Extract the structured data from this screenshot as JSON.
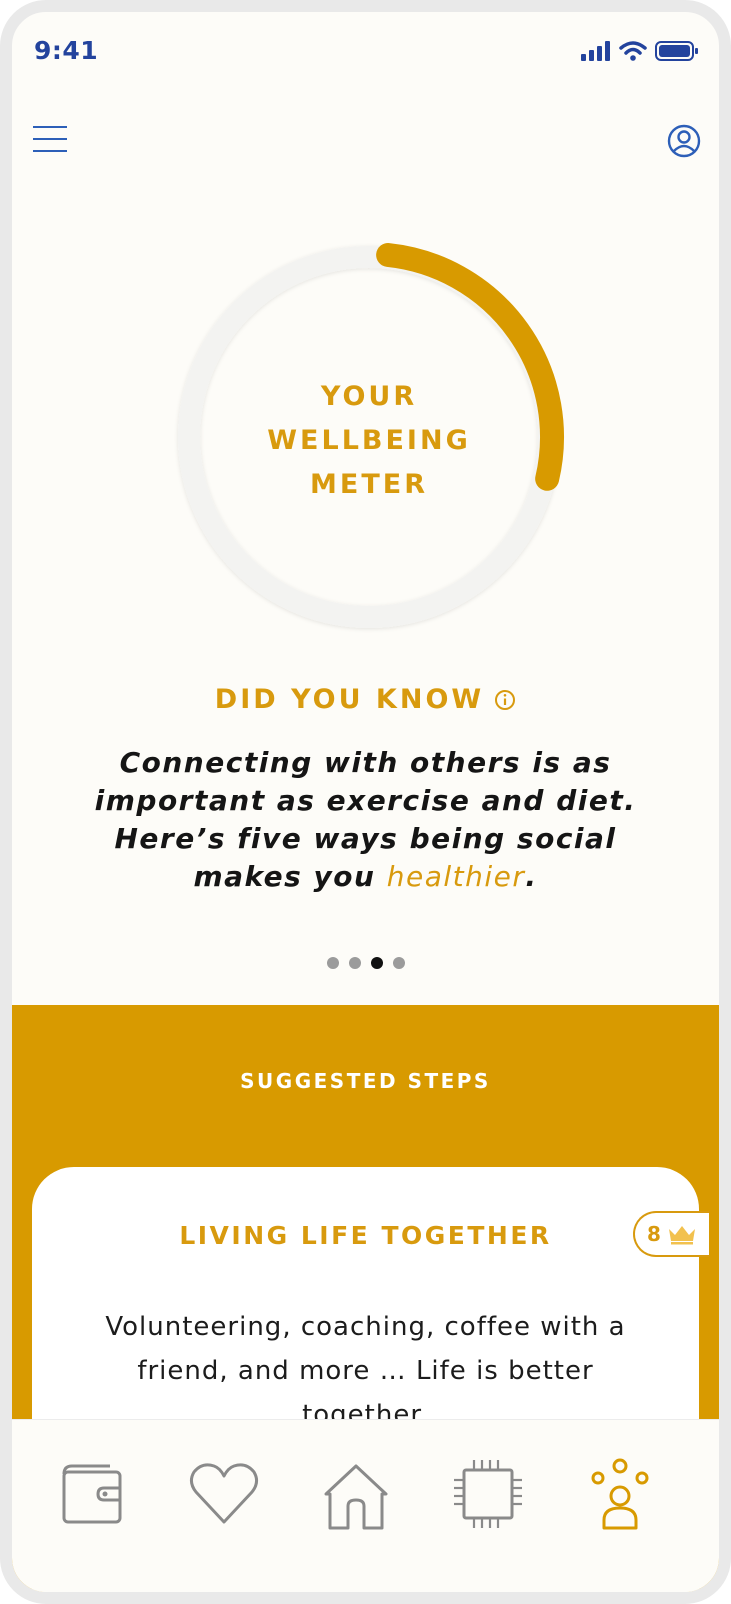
{
  "status_bar": {
    "time": "9:41",
    "icons": [
      "signal-icon",
      "wifi-icon",
      "battery-icon"
    ]
  },
  "header": {
    "menu_icon": "hamburger-menu-icon",
    "profile_icon": "user-profile-icon"
  },
  "meter": {
    "label_lines": [
      "YOUR",
      "WELLBEING",
      "METER"
    ],
    "progress": 0.27,
    "track_color": "#f3f3f1",
    "fill_color": "#d89a00"
  },
  "did_you_know": {
    "title": "DID YOU KNOW",
    "info_icon": "info-icon",
    "text_lines": [
      "Connecting with others is as",
      "important as exercise and diet.",
      "Here’s five ways being social"
    ],
    "last_line_prefix": "makes you ",
    "highlight": "healthier",
    "last_line_suffix": ".",
    "pager": {
      "count": 4,
      "active_index": 2
    }
  },
  "suggested_steps": {
    "title": "SUGGESTED STEPS",
    "card": {
      "title": "LIVING LIFE TOGETHER",
      "badge_count": "8",
      "badge_icon": "crown-icon",
      "description_lines": [
        "Volunteering, coaching, coffee with a",
        "friend, and more … Life is better",
        "together."
      ]
    }
  },
  "bottom_nav": {
    "items": [
      {
        "icon": "wallet-icon",
        "active": false
      },
      {
        "icon": "heart-icon",
        "active": false
      },
      {
        "icon": "home-icon",
        "active": false
      },
      {
        "icon": "chip-icon",
        "active": false
      },
      {
        "icon": "community-icon",
        "active": true
      }
    ]
  },
  "colors": {
    "accent": "#d89a00",
    "status_blue": "#23439d",
    "nav_inactive": "#8a8a8a",
    "background": "#fdfcf8"
  }
}
